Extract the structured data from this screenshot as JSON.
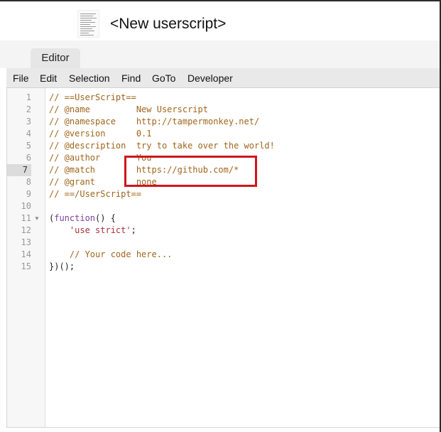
{
  "header": {
    "title": "<New userscript>",
    "logo_icon": "tampermonkey-script-icon"
  },
  "tabs": [
    {
      "label": "Editor",
      "active": true
    }
  ],
  "menu": {
    "items": [
      "File",
      "Edit",
      "Selection",
      "Find",
      "GoTo",
      "Developer"
    ]
  },
  "editor": {
    "active_line": 7,
    "lines": [
      {
        "num": "1",
        "segments": [
          {
            "t": "// ==UserScript==",
            "c": "cm"
          }
        ]
      },
      {
        "num": "2",
        "segments": [
          {
            "t": "// @name         New Userscript",
            "c": "cm"
          }
        ]
      },
      {
        "num": "3",
        "segments": [
          {
            "t": "// @namespace    http://tampermonkey.net/",
            "c": "cm"
          }
        ]
      },
      {
        "num": "4",
        "segments": [
          {
            "t": "// @version      0.1",
            "c": "cm"
          }
        ]
      },
      {
        "num": "5",
        "segments": [
          {
            "t": "// @description  try to take over the world!",
            "c": "cm"
          }
        ]
      },
      {
        "num": "6",
        "segments": [
          {
            "t": "// @author       You",
            "c": "cm"
          }
        ]
      },
      {
        "num": "7",
        "segments": [
          {
            "t": "// @match        https://github.com/*",
            "c": "cm"
          }
        ]
      },
      {
        "num": "8",
        "segments": [
          {
            "t": "// @grant        none",
            "c": "cm"
          }
        ]
      },
      {
        "num": "9",
        "segments": [
          {
            "t": "// ==/UserScript==",
            "c": "cm"
          }
        ]
      },
      {
        "num": "10",
        "segments": [
          {
            "t": "",
            "c": "plain"
          }
        ]
      },
      {
        "num": "11",
        "fold": "▼",
        "segments": [
          {
            "t": "(",
            "c": "plain"
          },
          {
            "t": "function",
            "c": "kw"
          },
          {
            "t": "() {",
            "c": "plain"
          }
        ]
      },
      {
        "num": "12",
        "segments": [
          {
            "t": "    ",
            "c": "plain"
          },
          {
            "t": "'use strict'",
            "c": "str"
          },
          {
            "t": ";",
            "c": "plain"
          }
        ]
      },
      {
        "num": "13",
        "segments": [
          {
            "t": "",
            "c": "plain"
          }
        ]
      },
      {
        "num": "14",
        "segments": [
          {
            "t": "    // Your code here...",
            "c": "cm"
          }
        ]
      },
      {
        "num": "15",
        "segments": [
          {
            "t": "})();",
            "c": "plain"
          }
        ]
      }
    ]
  },
  "annotation_color": "#d0151b"
}
